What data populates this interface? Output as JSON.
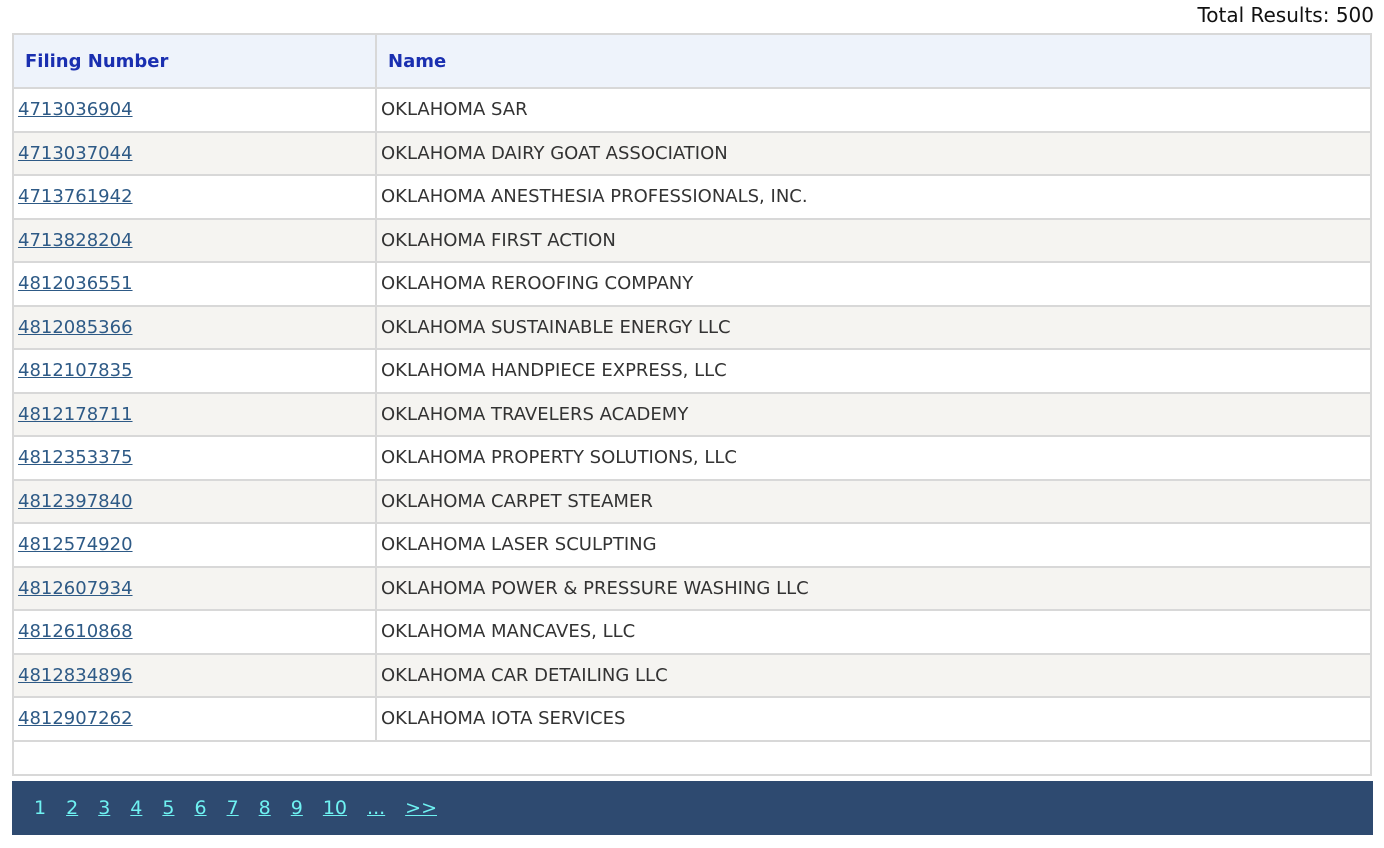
{
  "total_results": "Total Results: 500",
  "table": {
    "headers": [
      "Filing Number",
      "Name"
    ],
    "rows": [
      {
        "filing": "4713036904",
        "name": "OKLAHOMA SAR"
      },
      {
        "filing": "4713037044",
        "name": "OKLAHOMA DAIRY GOAT ASSOCIATION"
      },
      {
        "filing": "4713761942",
        "name": "OKLAHOMA ANESTHESIA PROFESSIONALS, INC."
      },
      {
        "filing": "4713828204",
        "name": "OKLAHOMA FIRST ACTION"
      },
      {
        "filing": "4812036551",
        "name": "OKLAHOMA REROOFING COMPANY"
      },
      {
        "filing": "4812085366",
        "name": "OKLAHOMA SUSTAINABLE ENERGY LLC"
      },
      {
        "filing": "4812107835",
        "name": "OKLAHOMA HANDPIECE EXPRESS, LLC"
      },
      {
        "filing": "4812178711",
        "name": "OKLAHOMA TRAVELERS ACADEMY"
      },
      {
        "filing": "4812353375",
        "name": "OKLAHOMA PROPERTY SOLUTIONS, LLC"
      },
      {
        "filing": "4812397840",
        "name": "OKLAHOMA CARPET STEAMER"
      },
      {
        "filing": "4812574920",
        "name": "OKLAHOMA LASER SCULPTING"
      },
      {
        "filing": "4812607934",
        "name": "OKLAHOMA POWER & PRESSURE WASHING LLC"
      },
      {
        "filing": "4812610868",
        "name": "OKLAHOMA MANCAVES, LLC"
      },
      {
        "filing": "4812834896",
        "name": "OKLAHOMA CAR DETAILING LLC"
      },
      {
        "filing": "4812907262",
        "name": "OKLAHOMA IOTA SERVICES"
      }
    ]
  },
  "pager": {
    "items": [
      "1",
      "2",
      "3",
      "4",
      "5",
      "6",
      "7",
      "8",
      "9",
      "10",
      "...",
      ">>"
    ],
    "current": "1"
  },
  "colors": {
    "header_text": "#1a2fb0",
    "header_bg": "#eef3fb",
    "link": "#2e5a86",
    "alt_row": "#f5f4f1",
    "pager_bg": "#2e4a70",
    "pager_link": "#6ff2f2"
  }
}
